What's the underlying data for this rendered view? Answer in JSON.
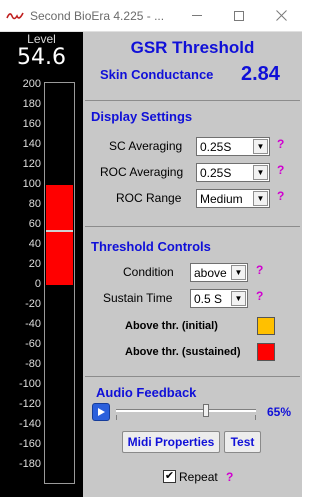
{
  "window": {
    "title": "Second BioEra 4.225 - ...",
    "icons": {
      "app": "waveform-icon",
      "minimize": "minimize-icon",
      "maximize": "maximize-icon",
      "close": "close-icon"
    }
  },
  "meter": {
    "label": "Level",
    "value": "54.6",
    "scale": {
      "max": 200,
      "min": -180
    },
    "ticks": [
      "200",
      "180",
      "160",
      "140",
      "120",
      "100",
      "80",
      "60",
      "40",
      "20",
      "0",
      "-20",
      "-40",
      "-60",
      "-80",
      "-100",
      "-120",
      "-140",
      "-160",
      "-180"
    ],
    "fill": {
      "from": 0,
      "to": 100,
      "separator": 54.6
    },
    "fill_color": "#ff0000"
  },
  "header": {
    "title": "GSR Threshold",
    "sc_label": "Skin Conductance",
    "sc_value": "2.84"
  },
  "display_settings": {
    "heading": "Display Settings",
    "sc_averaging": {
      "label": "SC Averaging",
      "value": "0.25S"
    },
    "roc_averaging": {
      "label": "ROC Averaging",
      "value": "0.25S"
    },
    "roc_range": {
      "label": "ROC Range",
      "value": "Medium"
    }
  },
  "threshold_controls": {
    "heading": "Threshold Controls",
    "condition": {
      "label": "Condition",
      "value": "above"
    },
    "sustain_time": {
      "label": "Sustain Time",
      "value": "0.5 S"
    },
    "above_initial": {
      "label": "Above thr. (initial)",
      "color": "#ffc000"
    },
    "above_sustained": {
      "label": "Above thr. (sustained)",
      "color": "#ff0000"
    }
  },
  "audio_feedback": {
    "heading": "Audio Feedback",
    "volume_percent": "65%",
    "volume_fraction": 0.65,
    "midi_button": "Midi Properties",
    "test_button": "Test",
    "repeat_label": "Repeat",
    "repeat_checked": "✔"
  },
  "help_mark": "?",
  "accent_color": "#1010d8",
  "help_color": "#d000d0"
}
